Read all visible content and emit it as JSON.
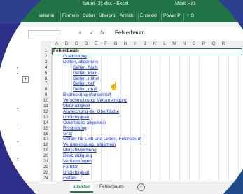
{
  "titlebar": {
    "filename": "baum (3).xlsx  -  Excel",
    "user": "Mark Hall"
  },
  "ribbon_tabs": [
    "seitenle",
    "Formeln",
    "Daten",
    "Überprü",
    "Ansicht",
    "Entwickl",
    "Power P",
    "♀ S"
  ],
  "formula": {
    "cancel": "×",
    "enter": "✓",
    "fx": "fx",
    "value": "Fehlerbaum"
  },
  "columns": [
    "A",
    "B",
    "C",
    "D",
    "E",
    "F",
    "G",
    "H",
    "I",
    "J",
    "K",
    "L",
    "M",
    "N",
    "O",
    "P",
    "Q",
    "R"
  ],
  "rows": [
    {
      "n": "1",
      "text": "Fehlerbaum",
      "indent": 0,
      "style": "head"
    },
    {
      "n": "2",
      "text": "Gratbildung",
      "indent": 1,
      "style": "link"
    },
    {
      "n": "3",
      "text": "Dellen, allgemein",
      "indent": 1,
      "style": "link"
    },
    {
      "n": "4",
      "text": "Dellen, flach",
      "indent": 2,
      "style": "link"
    },
    {
      "n": "5",
      "text": "Dellen, klein",
      "indent": 2,
      "style": "link"
    },
    {
      "n": "6",
      "text": "Dellen, mittel",
      "indent": 2,
      "style": "link"
    },
    {
      "n": "7",
      "text": "Dellen, tief",
      "indent": 2,
      "style": "link"
    },
    {
      "n": "8",
      "text": "Dellen, groß",
      "indent": 2,
      "style": "link"
    },
    {
      "n": "9",
      "text": "Bedruckung mangelhaft",
      "indent": 1,
      "style": "link"
    },
    {
      "n": "10",
      "text": "Verschmutzung/ Verunreinigung",
      "indent": 1,
      "style": "link"
    },
    {
      "n": "11",
      "text": "Maßhaltigkeit",
      "indent": 1,
      "style": "link"
    },
    {
      "n": "12",
      "text": "Abweichung der Oberfläche",
      "indent": 1,
      "style": "link"
    },
    {
      "n": "13",
      "text": "Undichtigkeit",
      "indent": 1,
      "style": "link"
    },
    {
      "n": "14",
      "text": "Oberfläche allgemein",
      "indent": 1,
      "style": "link"
    },
    {
      "n": "15",
      "text": "Rissbildung",
      "indent": 1,
      "style": "link"
    },
    {
      "n": "16",
      "text": "Grat",
      "indent": 1,
      "style": "link"
    },
    {
      "n": "17",
      "text": "Gefahr für Leib und Leben, Feldrückruf",
      "indent": 1,
      "style": "link"
    },
    {
      "n": "18",
      "text": "Verunreinigung, allgemein",
      "indent": 1,
      "style": "link"
    },
    {
      "n": "19",
      "text": "Maßabweichung",
      "indent": 1,
      "style": "link"
    },
    {
      "n": "20",
      "text": "Beschädigung",
      "indent": 1,
      "style": "link"
    },
    {
      "n": "21",
      "text": "Verformungen",
      "indent": 1,
      "style": "link"
    },
    {
      "n": "22",
      "text": "Farbton",
      "indent": 1,
      "style": "link"
    },
    {
      "n": "23",
      "text": "Undichtigkeit",
      "indent": 1,
      "style": "link"
    },
    {
      "n": "24",
      "text": "Gefahr...",
      "indent": 1,
      "style": "link"
    }
  ],
  "sheet_tabs": {
    "active": "struktur",
    "other": "Fehlerbaum",
    "add": "+"
  }
}
